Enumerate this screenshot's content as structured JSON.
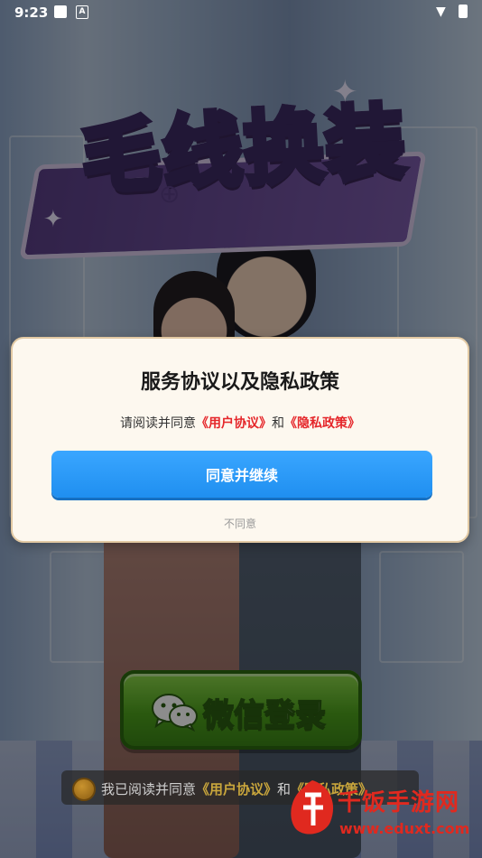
{
  "status_bar": {
    "time": "9:23",
    "a_badge": "A"
  },
  "game": {
    "title": "毛线换装"
  },
  "dialog": {
    "title": "服务协议以及隐私政策",
    "desc_prefix": "请阅读并同意",
    "user_agreement": "《用户协议》",
    "conjunction": "和",
    "privacy_policy": "《隐私政策》",
    "agree_label": "同意并继续",
    "disagree_label": "不同意"
  },
  "login": {
    "wechat_label": "微信登录"
  },
  "agreement_bar": {
    "prefix": "我已阅读并同意",
    "user_agreement": "《用户协议》",
    "conjunction": "和",
    "privacy_policy": "《隐私政策》"
  },
  "watermark": {
    "name": "千饭手游网",
    "url": "www.eduxt.com"
  },
  "colors": {
    "agree_button": "#1f8ff0",
    "link_red": "#e5262a",
    "wechat_green": "#4ea21d",
    "watermark_red": "#e0291f"
  }
}
